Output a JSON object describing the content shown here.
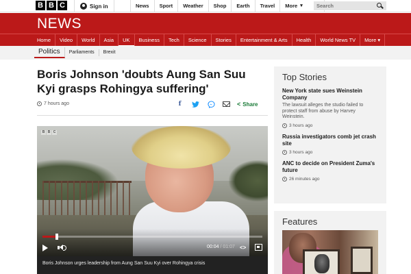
{
  "brand": {
    "letters": [
      "B",
      "B",
      "C"
    ]
  },
  "topbar": {
    "signin_label": "Sign in",
    "nav": [
      "News",
      "Sport",
      "Weather",
      "Shop",
      "Earth",
      "Travel",
      "More"
    ],
    "search_placeholder": "Search"
  },
  "news_header": {
    "title": "NEWS"
  },
  "main_nav": {
    "items": [
      "Home",
      "Video",
      "World",
      "Asia",
      "UK",
      "Business",
      "Tech",
      "Science",
      "Stories",
      "Entertainment & Arts",
      "Health",
      "World News TV",
      "More ▾"
    ],
    "active": "UK"
  },
  "sub_nav": {
    "items": [
      "Politics",
      "Parliaments",
      "Brexit"
    ],
    "active": "Politics"
  },
  "article": {
    "headline": "Boris Johnson 'doubts Aung San Suu Kyi grasps Rohingya suffering'",
    "time_ago": "7 hours ago",
    "share_label": "Share",
    "video": {
      "current_time": "00:04",
      "duration": "/ 01:07",
      "progress": 0.06,
      "caption": "Boris Johnson urges leadership from Aung San Suu Kyi over Rohingya crisis"
    }
  },
  "sidebar": {
    "top_stories_title": "Top Stories",
    "stories": [
      {
        "title": "New York state sues Weinstein Company",
        "summary": "The lawsuit alleges the studio failed to protect staff from abuse by Harvey Weinstein.",
        "time": "3 hours ago"
      },
      {
        "title": "Russia investigators comb jet crash site",
        "summary": "",
        "time": "3 hours ago"
      },
      {
        "title": "ANC to decide on President Zuma's future",
        "summary": "",
        "time": "26 minutes ago"
      }
    ],
    "features_title": "Features"
  },
  "colors": {
    "brand_red": "#bb1919",
    "share_green": "#1a7a37"
  }
}
